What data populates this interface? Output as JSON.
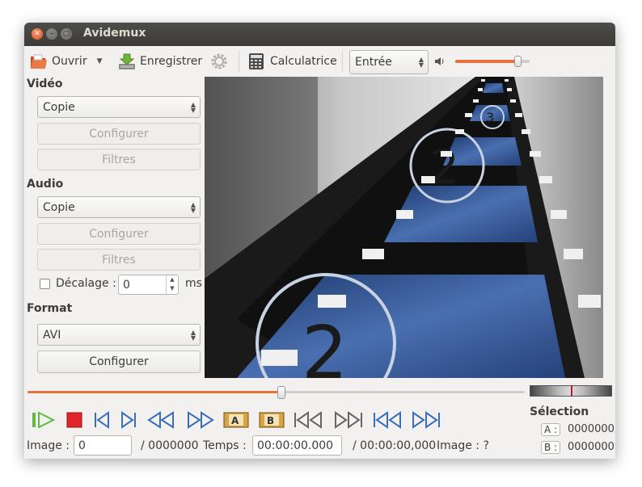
{
  "window": {
    "title": "Avidemux"
  },
  "toolbar": {
    "open_label": "Ouvrir",
    "save_label": "Enregistrer",
    "calculator_label": "Calculatrice",
    "view_mode": "Entrée",
    "volume_level_percent": 88
  },
  "video": {
    "section_label": "Vidéo",
    "codec": "Copie",
    "configure_label": "Configurer",
    "filters_label": "Filtres"
  },
  "audio": {
    "section_label": "Audio",
    "codec": "Copie",
    "configure_label": "Configurer",
    "filters_label": "Filtres",
    "offset_label": "Décalage :",
    "offset_value": "0",
    "offset_unit": "ms"
  },
  "format": {
    "section_label": "Format",
    "container": "AVI",
    "configure_label": "Configurer"
  },
  "playback": {
    "seek_position_percent": 51
  },
  "selection": {
    "title": "Sélection",
    "a_label": "A :",
    "a_value": "0000000",
    "b_label": "B :",
    "b_value": "0000000"
  },
  "status": {
    "frame_label": "Image :",
    "frame_value": "0",
    "frame_total": "/ 0000000",
    "time_label": "Temps :",
    "time_value": "00:00:00.000",
    "time_total": "/ 00:00:00,000",
    "frame_type": "Image : ?"
  },
  "colors": {
    "accent": "#e8713c",
    "titlebar": "#3c3b37",
    "nav_icon": "#3a6fb8",
    "play_green": "#5fbb3f",
    "stop_red": "#e0262a"
  }
}
